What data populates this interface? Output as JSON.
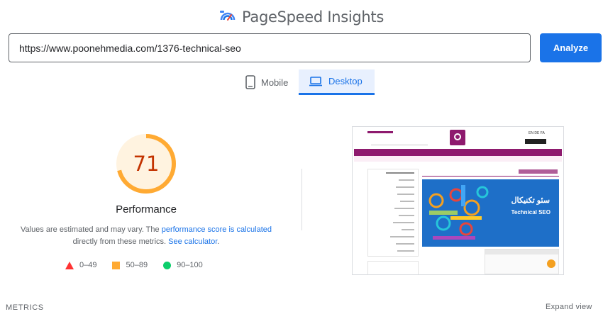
{
  "header": {
    "title": "PageSpeed Insights",
    "logo_icon": "pagespeed-logo-icon"
  },
  "search": {
    "url_value": "https://www.poonehmedia.com/1376-technical-seo",
    "analyze_label": "Analyze"
  },
  "tabs": [
    {
      "label": "Mobile",
      "icon": "mobile-phone-icon",
      "active": false
    },
    {
      "label": "Desktop",
      "icon": "laptop-icon",
      "active": true
    }
  ],
  "performance": {
    "score": "71",
    "score_fraction": 0.71,
    "title": "Performance",
    "desc_prefix": "Values are estimated and may vary. The ",
    "desc_link1": "performance score is calculated",
    "desc_middle": " directly from these metrics. ",
    "desc_link2": "See calculator",
    "desc_suffix": ".",
    "score_color": "#ffaa33",
    "score_text_color": "#c33300"
  },
  "legend": [
    {
      "shape": "triangle",
      "color": "#ff3333",
      "range": "0–49"
    },
    {
      "shape": "square",
      "color": "#ffaa33",
      "range": "50–89"
    },
    {
      "shape": "circle",
      "color": "#0cce6b",
      "range": "90–100"
    }
  ],
  "screenshot": {
    "hero_text_fa": "سئو تکنیکال",
    "hero_text_en": "Technical SEO",
    "lang_switch": "EN DE FA",
    "accent_color": "#8e1a6e",
    "hero_color": "#1e6fc8"
  },
  "footer": {
    "metrics_label": "METRICS",
    "expand_label": "Expand view"
  }
}
